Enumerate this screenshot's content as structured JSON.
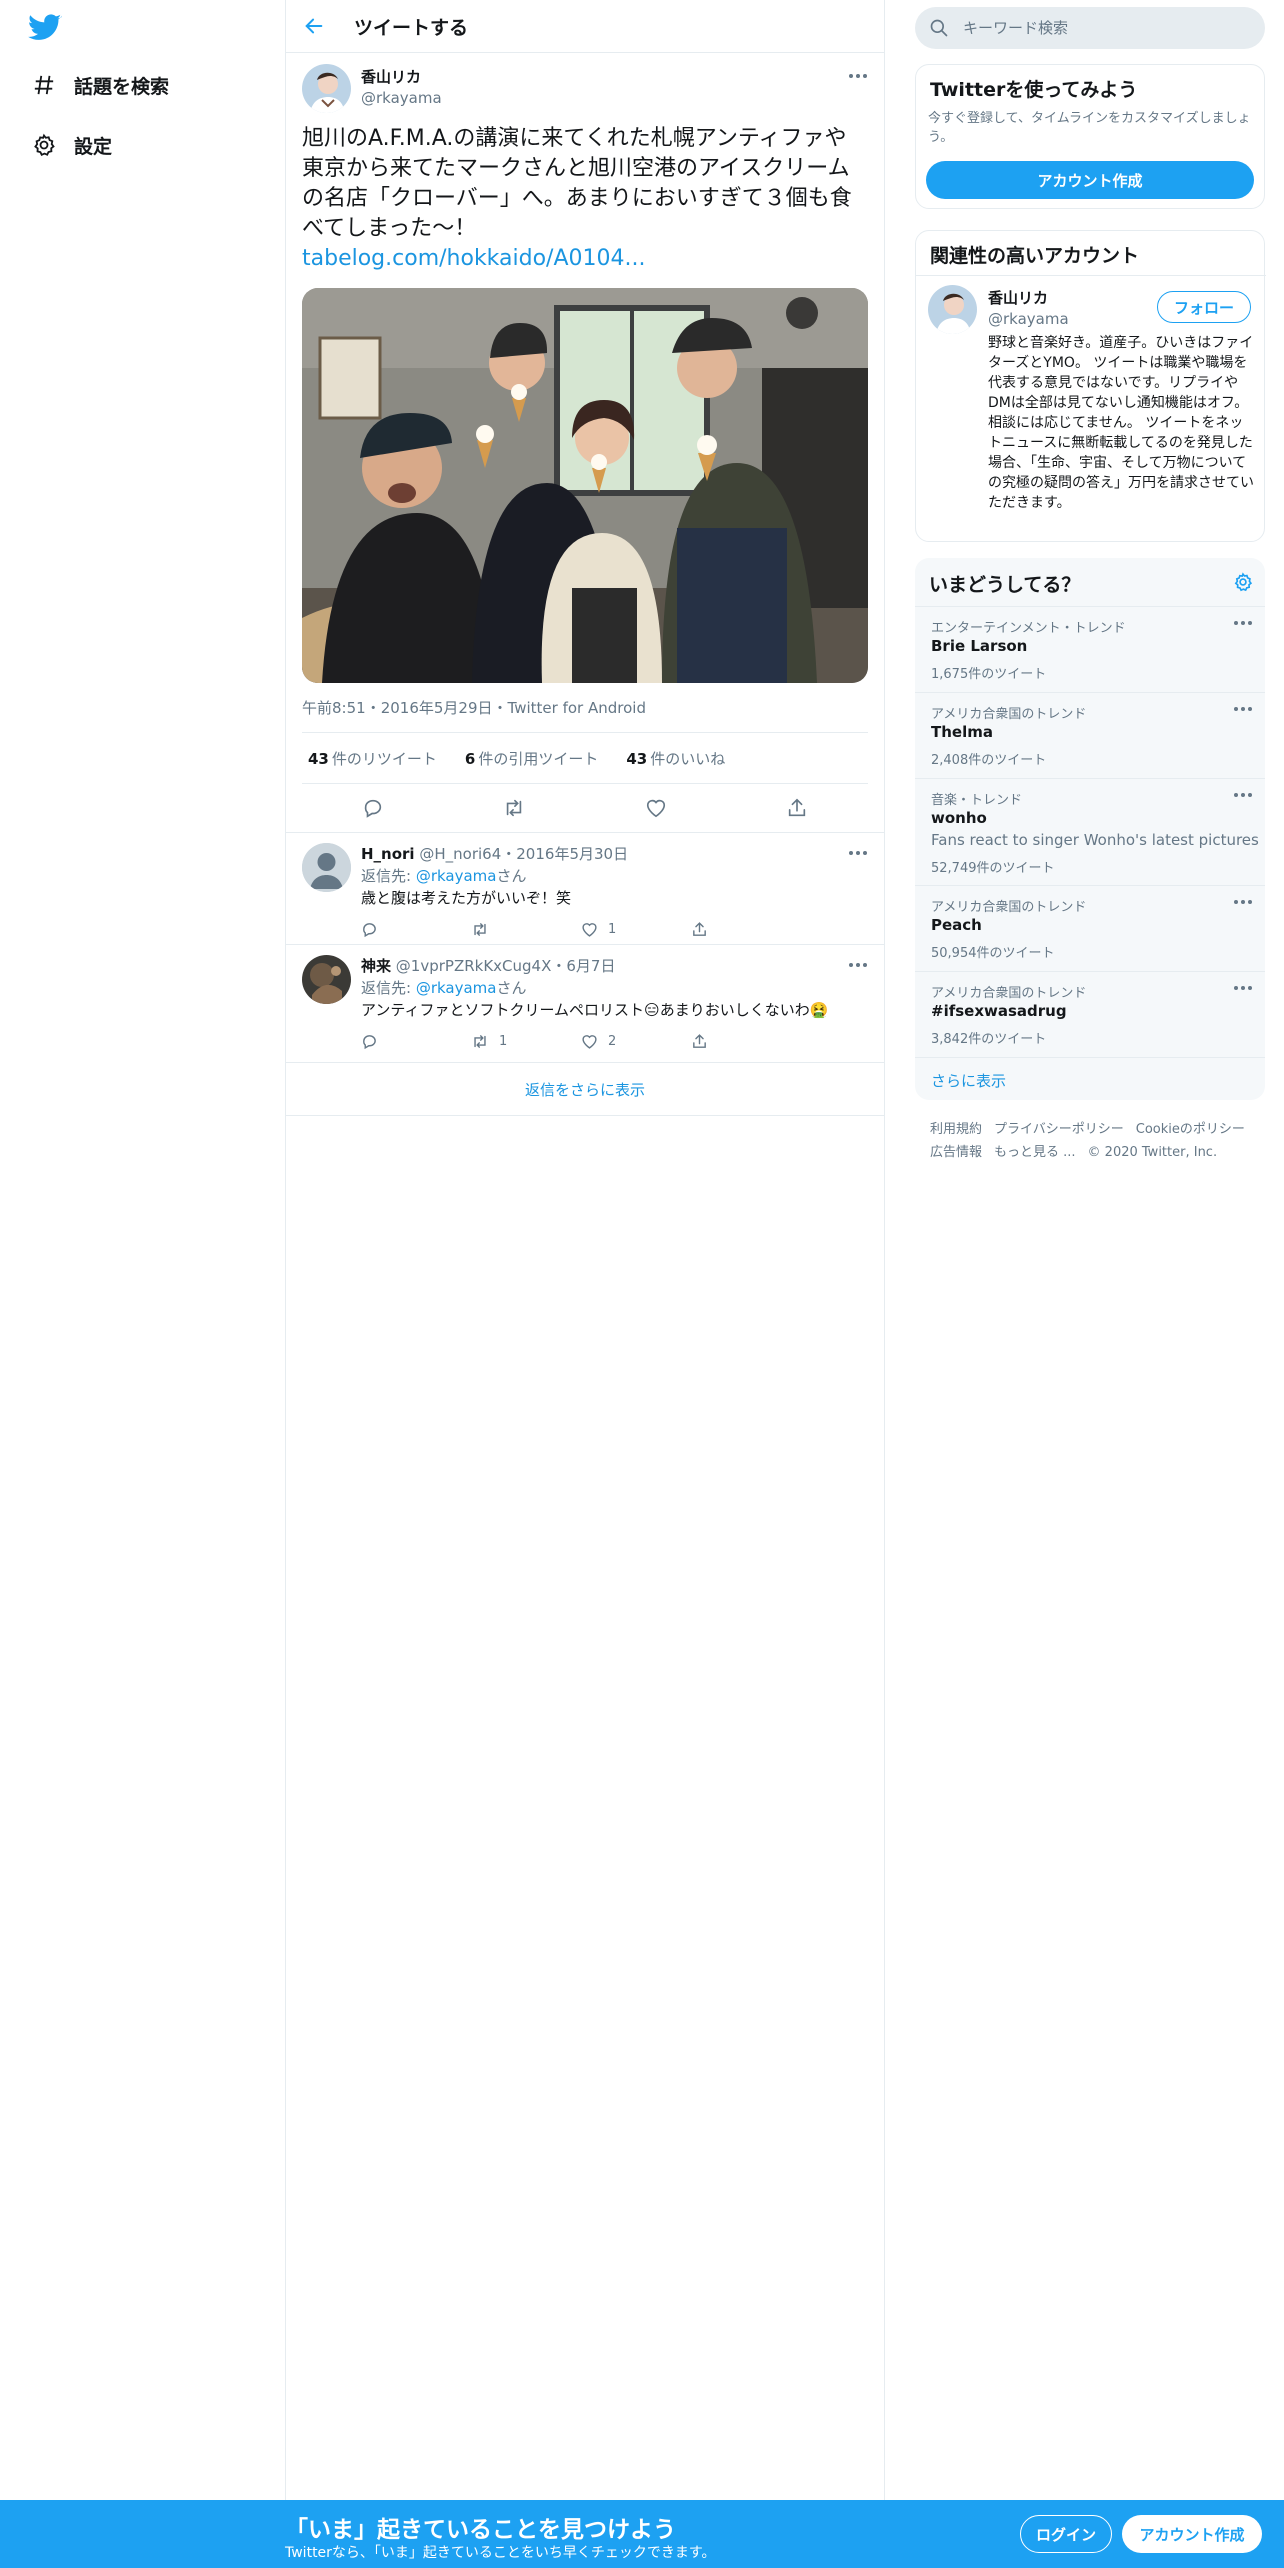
{
  "nav": {
    "explore_label": "話題を検索",
    "settings_label": "設定"
  },
  "header": {
    "title": "ツイートする"
  },
  "tweet": {
    "name": "香山リカ",
    "handle": "@rkayama",
    "text": "旭川のA.F.M.A.の講演に来てくれた札幌アンティファや東京から来てたマークさんと旭川空港のアイスクリームの名店「クローバー」へ。あまりにおいすぎて３個も食べてしまった～！",
    "link": "tabelog.com/hokkaido/A0104...",
    "time": "午前8:51",
    "date": "2016年5月29日",
    "source": "Twitter for Android",
    "dot": "・",
    "retweets": "43",
    "retweets_label": "件のリツイート",
    "quotes": "6",
    "quotes_label": "件の引用ツイート",
    "likes": "43",
    "likes_label": "件のいいね"
  },
  "replies": [
    {
      "name": "H_nori",
      "handle": "@H_nori64",
      "date": "2016年5月30日",
      "replying_prefix": "返信先: ",
      "replying_to": "@rkayama",
      "replying_suffix": "さん",
      "text": "歳と腹は考えた方がいいぞ！笑",
      "retweets": "",
      "likes": "1"
    },
    {
      "name": "神来",
      "handle": "@1vprPZRkKxCug4X",
      "date": "6月7日",
      "replying_prefix": "返信先: ",
      "replying_to": "@rkayama",
      "replying_suffix": "さん",
      "text": "アンティファとソフトクリームペロリスト😑あまりおいしくないわ🤮",
      "retweets": "1",
      "likes": "2"
    }
  ],
  "show_more_replies": "返信をさらに表示",
  "search": {
    "placeholder": "キーワード検索"
  },
  "signup_card": {
    "title": "Twitterを使ってみよう",
    "subtitle": "今すぐ登録して、タイムラインをカスタマイズしましょう。",
    "button": "アカウント作成"
  },
  "related": {
    "title": "関連性の高いアカウント",
    "name": "香山リカ",
    "handle": "@rkayama",
    "follow": "フォロー",
    "bio": "野球と音楽好き。道産子。ひいきはファイターズとYMO。 ツイートは職業や職場を代表する意見ではないです。リプライやDMは全部は見てないし通知機能はオフ。相談には応じてません。 ツイートをネットニュースに無断転載してるのを発見した場合、「生命、宇宙、そして万物についての究極の疑問の答え」万円を請求させていただきます。"
  },
  "trends": {
    "title": "いまどうしてる？",
    "items": [
      {
        "category": "エンターテインメント・トレンド",
        "name": "Brie Larson",
        "description": "",
        "count": "1,675件のツイート"
      },
      {
        "category": "アメリカ合衆国のトレンド",
        "name": "Thelma",
        "description": "",
        "count": "2,408件のツイート"
      },
      {
        "category": "音楽・トレンド",
        "name": "wonho",
        "description": "Fans react to singer Wonho's latest pictures",
        "count": "52,749件のツイート"
      },
      {
        "category": "アメリカ合衆国のトレンド",
        "name": "Peach",
        "description": "",
        "count": "50,954件のツイート"
      },
      {
        "category": "アメリカ合衆国のトレンド",
        "name": "#ifsexwasadrug",
        "description": "",
        "count": "3,842件のツイート"
      }
    ],
    "show_more": "さらに表示"
  },
  "footer": {
    "links": [
      "利用規約",
      "プライバシーポリシー",
      "Cookieのポリシー",
      "広告情報",
      "もっと見る ..."
    ],
    "copyright": "© 2020 Twitter, Inc."
  },
  "bottom_bar": {
    "headline": "「いま」起きていることを見つけよう",
    "subline": "Twitterなら、「いま」起きていることをいち早くチェックできます。",
    "login": "ログイン",
    "signup": "アカウント作成"
  },
  "colors": {
    "brand": "#1da1f2",
    "link": "#1b95e0",
    "text": "#14171a",
    "secondary": "#657786",
    "border": "#e6ecf0"
  }
}
